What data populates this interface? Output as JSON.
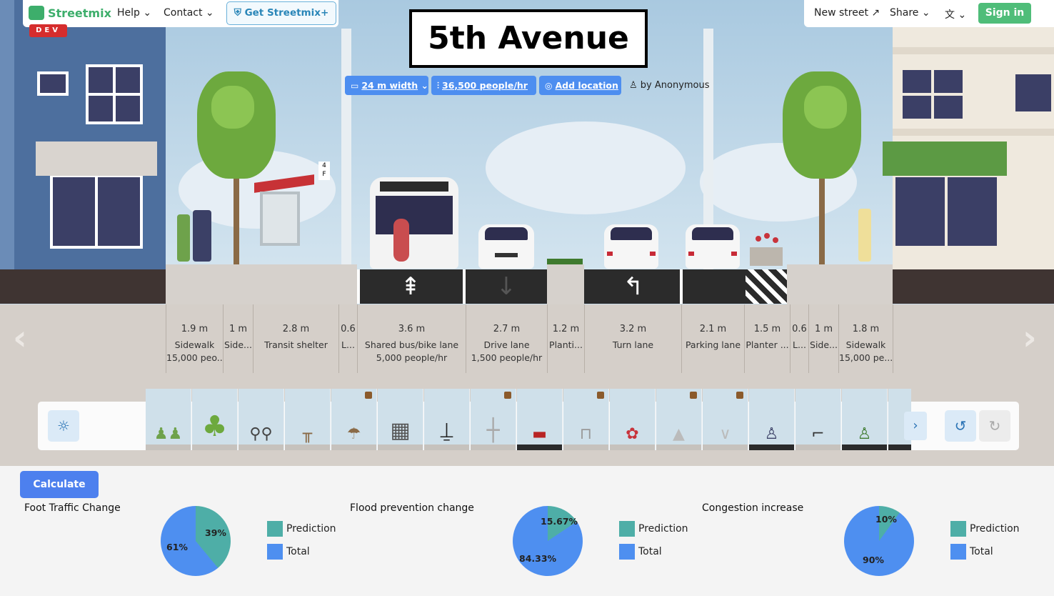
{
  "topbar": {
    "logo": "Streetmix",
    "env_badge": "DEV",
    "help": "Help",
    "contact": "Contact",
    "get_plus": "Get Streetmix+",
    "new_street": "New street",
    "share": "Share",
    "signin": "Sign in"
  },
  "street": {
    "name": "5th Avenue",
    "width": "24 m width",
    "capacity": "36,500 people/hr",
    "add_location": "Add location",
    "author": "by Anonymous"
  },
  "segments": [
    {
      "width": "1.9 m",
      "name": "Sidewalk",
      "capacity": "15,000 peo..."
    },
    {
      "width": "1 m",
      "name": "Side...",
      "capacity": ""
    },
    {
      "width": "2.8 m",
      "name": "Transit shelter",
      "capacity": ""
    },
    {
      "width": "0.6",
      "name": "L...",
      "capacity": ""
    },
    {
      "width": "3.6 m",
      "name": "Shared bus/bike lane",
      "capacity": "5,000 people/hr"
    },
    {
      "width": "2.7 m",
      "name": "Drive lane",
      "capacity": "1,500 people/hr"
    },
    {
      "width": "1.2 m",
      "name": "Planti...",
      "capacity": ""
    },
    {
      "width": "3.2 m",
      "name": "Turn lane",
      "capacity": ""
    },
    {
      "width": "2.1 m",
      "name": "Parking lane",
      "capacity": ""
    },
    {
      "width": "1.5 m",
      "name": "Planter ...",
      "capacity": ""
    },
    {
      "width": "0.6",
      "name": "L...",
      "capacity": ""
    },
    {
      "width": "1 m",
      "name": "Side...",
      "capacity": ""
    },
    {
      "width": "1.8 m",
      "name": "Sidewalk",
      "capacity": "15,000 pe..."
    }
  ],
  "palette": {
    "tiles": [
      "people",
      "tree",
      "bike-rack",
      "bench",
      "cafe-table",
      "newspaper-box",
      "lamp",
      "utility-pole",
      "planter-box",
      "vendor",
      "flowers",
      "cone",
      "divider",
      "cyclist",
      "scooter",
      "bike-rider"
    ]
  },
  "analytics": {
    "calculate": "Calculate",
    "charts": [
      {
        "title": "Foot Traffic Change",
        "prediction_label": "39%",
        "total_label": "61%"
      },
      {
        "title": "Flood prevention change",
        "prediction_label": "15.67%",
        "total_label": "84.33%"
      },
      {
        "title": "Congestion increase",
        "prediction_label": "10%",
        "total_label": "90%"
      }
    ],
    "legend": {
      "prediction": "Prediction",
      "total": "Total"
    }
  },
  "chart_data": [
    {
      "type": "pie",
      "title": "Foot Traffic Change",
      "labels": [
        "Prediction",
        "Total"
      ],
      "values": [
        39,
        61
      ],
      "colors": [
        "#4eaea7",
        "#4e8ff0"
      ]
    },
    {
      "type": "pie",
      "title": "Flood prevention change",
      "labels": [
        "Prediction",
        "Total"
      ],
      "values": [
        15.67,
        84.33
      ],
      "colors": [
        "#4eaea7",
        "#4e8ff0"
      ]
    },
    {
      "type": "pie",
      "title": "Congestion increase",
      "labels": [
        "Prediction",
        "Total"
      ],
      "values": [
        10,
        90
      ],
      "colors": [
        "#4eaea7",
        "#4e8ff0"
      ]
    }
  ]
}
